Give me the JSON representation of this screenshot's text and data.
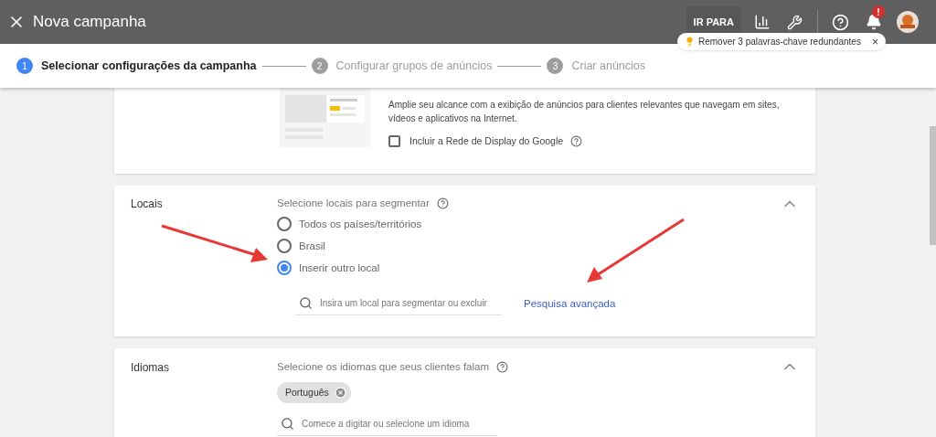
{
  "header": {
    "title": "Nova campanha",
    "goto_button": "IR PARA",
    "notification_badge": "!",
    "tip": {
      "text": "Remover 3 palavras-chave redundantes",
      "close": "×"
    }
  },
  "steps": [
    {
      "number": "1",
      "label": "Selecionar configurações da campanha",
      "selected": true
    },
    {
      "number": "2",
      "label": "Configurar grupos de anúncios",
      "selected": false
    },
    {
      "number": "3",
      "label": "Criar anúncios",
      "selected": false
    }
  ],
  "display_card": {
    "description": "Amplie seu alcance com a exibição de anúncios para clientes relevantes que navegam em sites, vídeos e aplicativos na Internet.",
    "checkbox": {
      "label": "Incluir a Rede de Display do Google",
      "checked": false
    }
  },
  "locations": {
    "title": "Locais",
    "prompt": "Selecione locais para segmentar",
    "options": [
      {
        "label": "Todos os países/territórios",
        "selected": false
      },
      {
        "label": "Brasil",
        "selected": false
      },
      {
        "label": "Inserir outro local",
        "selected": true
      }
    ],
    "search": {
      "placeholder": "Insira um local para segmentar ou excluir"
    },
    "link": "Pesquisa avançada",
    "expanded": true
  },
  "languages": {
    "title": "Idiomas",
    "prompt": "Selecione os idiomas que seus clientes falam",
    "chips": [
      "Português"
    ],
    "search": {
      "placeholder": "Comece a digitar ou selecione um idioma"
    },
    "expanded": true
  }
}
